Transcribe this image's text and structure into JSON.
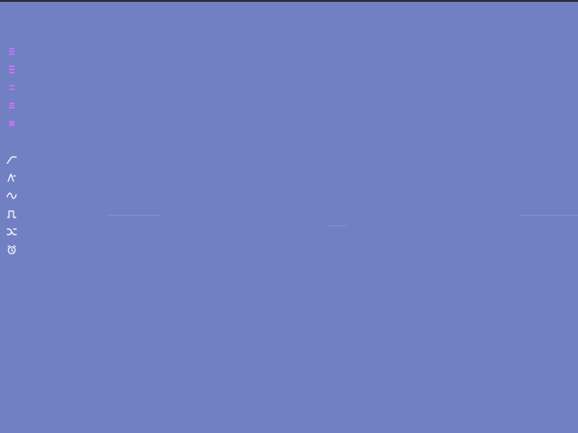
{
  "colors": {
    "background": "#717fc3",
    "topLine": "#2c2c34",
    "pinkIcon": "#e070ff",
    "whiteIcon": "#ffffff"
  },
  "toolbar": {
    "icons": [
      "line-style-icon-1",
      "line-style-icon-2",
      "line-style-icon-3",
      "line-style-icon-4",
      "line-style-icon-5",
      "ramp-wave-icon",
      "triangle-wave-icon",
      "sine-wave-icon",
      "square-wave-icon",
      "random-wave-icon",
      "alarm-icon"
    ]
  }
}
